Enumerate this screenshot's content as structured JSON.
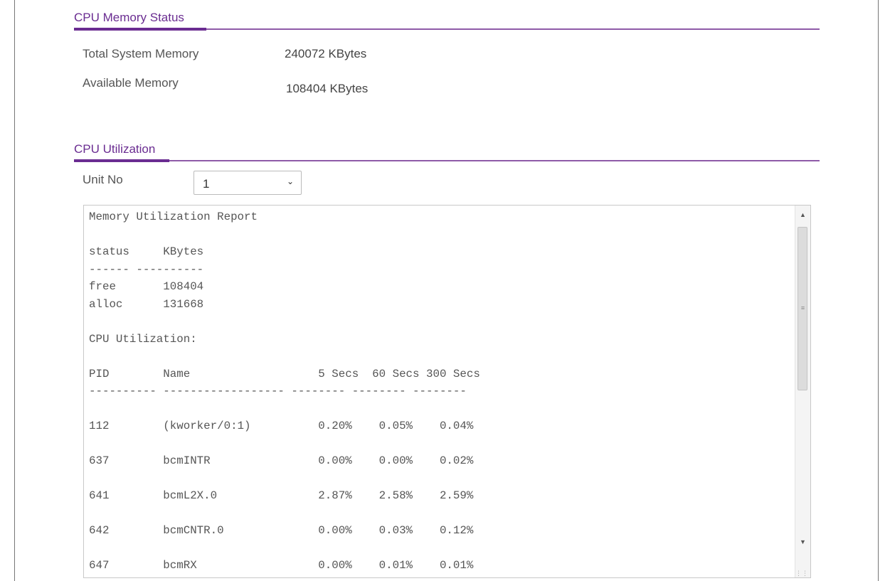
{
  "memory_section": {
    "title": "CPU Memory Status",
    "total_label": "Total System Memory",
    "total_value": "240072 KBytes",
    "available_label": "Available Memory",
    "available_value": "108404 KBytes"
  },
  "cpu_section": {
    "title": "CPU Utilization",
    "unit_label": "Unit No",
    "unit_value": "1",
    "unit_icon": "chevron-down-icon"
  },
  "report": {
    "text": "Memory Utilization Report\n\nstatus     KBytes\n------ ----------\nfree       108404\nalloc      131668\n\nCPU Utilization:\n\nPID        Name                   5 Secs  60 Secs 300 Secs\n---------- ------------------ -------- -------- --------\n\n112        (kworker/0:1)          0.20%    0.05%    0.04%\n\n637        bcmINTR                0.00%    0.00%    0.02%\n\n641        bcmL2X.0               2.87%    2.58%    2.59%\n\n642        bcmCNTR.0              0.00%    0.03%    0.12%\n\n647        bcmRX                  0.00%    0.01%    0.01%"
  },
  "colors": {
    "accent": "#6a2c91",
    "header_rule": "#8e5aa8"
  }
}
